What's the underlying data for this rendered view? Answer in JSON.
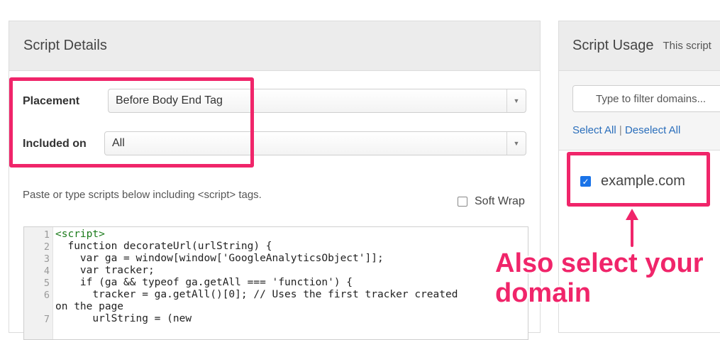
{
  "script_details": {
    "title": "Script Details",
    "placement_label": "Placement",
    "placement_value": "Before Body End Tag",
    "included_label": "Included on",
    "included_value": "All",
    "hint": "Paste or type scripts below including <script> tags.",
    "soft_wrap_label": "Soft Wrap"
  },
  "editor": {
    "line_numbers": [
      "1",
      "2",
      "3",
      "4",
      "5",
      "6",
      "",
      "7"
    ],
    "lines": [
      "<script>",
      "  function decorateUrl(urlString) {",
      "    var ga = window[window['GoogleAnalyticsObject']];",
      "    var tracker;",
      "    if (ga && typeof ga.getAll === 'function') {",
      "      tracker = ga.getAll()[0]; // Uses the first tracker created",
      "on the page",
      "      urlString = (new"
    ]
  },
  "script_usage": {
    "title": "Script Usage",
    "subtitle": "This script",
    "filter_placeholder": "Type to filter domains...",
    "select_all": "Select All",
    "separator": "|",
    "deselect_all": "Deselect All",
    "domain": "example.com",
    "domain_checked": true
  },
  "annotation": {
    "line1": "Also select your",
    "line2": "domain",
    "color": "#f0256a"
  },
  "icons": [
    "dropdown-arrow-icon",
    "checkbox-icon",
    "checkmark-icon",
    "up-arrow-icon"
  ]
}
